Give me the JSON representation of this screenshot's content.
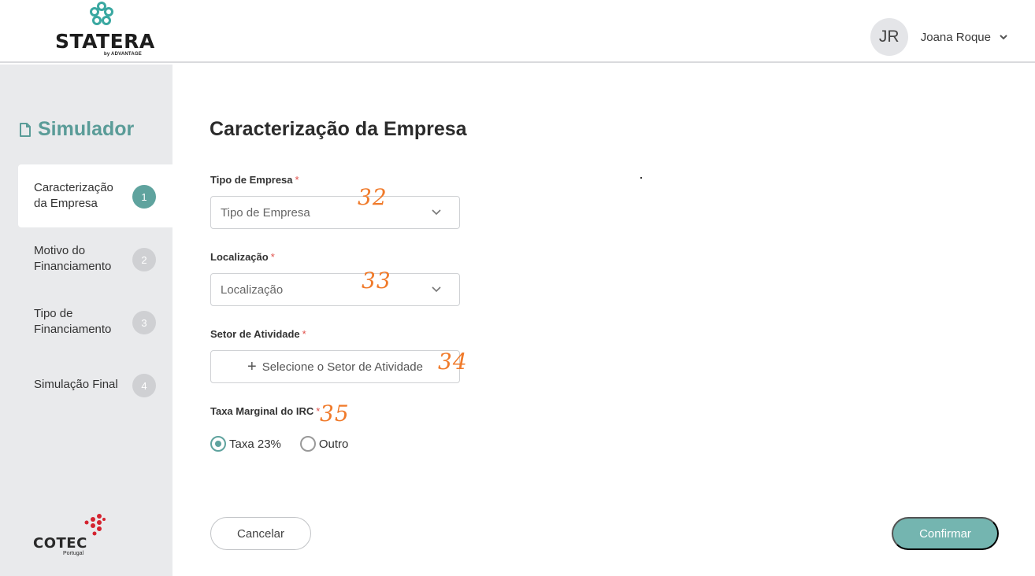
{
  "brand": {
    "name": "STATERA",
    "sub": "by ADVANTAGE",
    "accent_color": "#5fa39e",
    "partner_name": "COTEC",
    "partner_sub": "Portugal"
  },
  "user": {
    "initials": "JR",
    "name": "Joana Roque"
  },
  "sidebar": {
    "title": "Simulador",
    "title_icon": "document-icon",
    "steps": [
      {
        "label": "Caracterização da Empresa",
        "number": "1",
        "active": true
      },
      {
        "label": "Motivo do Financiamento",
        "number": "2",
        "active": false
      },
      {
        "label": "Tipo de Financiamento",
        "number": "3",
        "active": false
      },
      {
        "label": "Simulação Final",
        "number": "4",
        "active": false
      }
    ]
  },
  "main": {
    "title": "Caracterização da Empresa",
    "fields": {
      "tipo_empresa": {
        "label": "Tipo de Empresa",
        "required": "*",
        "placeholder": "Tipo de Empresa",
        "annotation": "32"
      },
      "localizacao": {
        "label": "Localização",
        "required": "*",
        "placeholder": "Localização",
        "annotation": "33"
      },
      "setor": {
        "label": "Setor de Atividade",
        "required": "*",
        "button_label": "Selecione o Setor de Atividade",
        "button_icon": "+",
        "annotation": "34"
      },
      "taxa": {
        "label": "Taxa Marginal do IRC",
        "required": "*",
        "annotation": "35",
        "options": [
          {
            "label": "Taxa 23%",
            "selected": true
          },
          {
            "label": "Outro",
            "selected": false
          }
        ]
      }
    },
    "buttons": {
      "cancel": "Cancelar",
      "confirm": "Confirmar"
    }
  }
}
